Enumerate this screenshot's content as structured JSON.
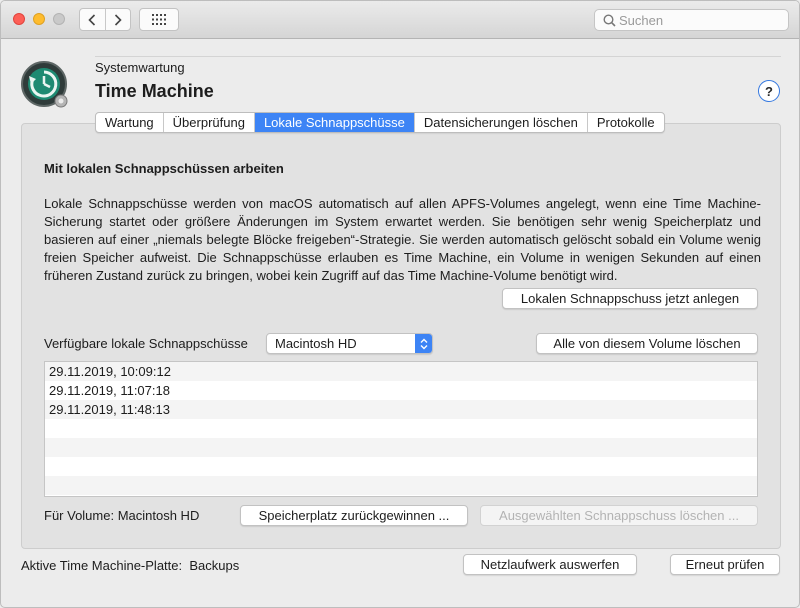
{
  "window": {
    "search_placeholder": "Suchen",
    "nav_back_icon": "chevron-left-icon",
    "nav_forward_icon": "chevron-right-icon",
    "grid_icon": "grid-icon"
  },
  "header": {
    "subtitle": "Systemwartung",
    "title": "Time Machine",
    "help_label": "?"
  },
  "tabs": [
    {
      "label": "Wartung",
      "active": false
    },
    {
      "label": "Überprüfung",
      "active": false
    },
    {
      "label": "Lokale Schnappschüsse",
      "active": true
    },
    {
      "label": "Datensicherungen löschen",
      "active": false
    },
    {
      "label": "Protokolle",
      "active": false
    }
  ],
  "content": {
    "section_title": "Mit lokalen Schnappschüssen arbeiten",
    "description": "Lokale Schnappschüsse werden von macOS automatisch auf allen APFS-Volumes angelegt, wenn eine Time Machine-Sicherung startet oder größere Änderungen im System erwartet werden. Sie benötigen sehr wenig Speicherplatz und basieren auf einer „niemals belegte Blöcke freigeben“-Strategie. Sie werden automatisch gelöscht sobald ein Volume wenig freien Speicher aufweist. Die Schnappschüsse erlauben es Time Machine, ein Volume in wenigen Sekunden auf einen früheren Zustand zurück zu bringen, wobei kein Zugriff auf das Time Machine-Volume benötigt wird.",
    "create_button": "Lokalen Schnappschuss jetzt anlegen",
    "volume_label": "Verfügbare lokale Schnappschüsse",
    "volume_selected": "Macintosh HD",
    "delete_all_button": "Alle von diesem Volume löschen",
    "snapshots": [
      "29.11.2019, 10:09:12",
      "29.11.2019, 11:07:18",
      "29.11.2019, 11:48:13",
      "",
      "",
      "",
      "",
      ""
    ],
    "for_volume": "Für Volume: Macintosh HD",
    "reclaim_button": "Speicherplatz zurückgewinnen ...",
    "delete_selected_button": "Ausgewählten Schnappschuss löschen ..."
  },
  "footer": {
    "active_disk": "Aktive Time Machine-Platte:  Backups",
    "eject_button": "Netzlaufwerk auswerfen",
    "recheck_button": "Erneut prüfen"
  },
  "colors": {
    "accent": "#3d84f5"
  }
}
